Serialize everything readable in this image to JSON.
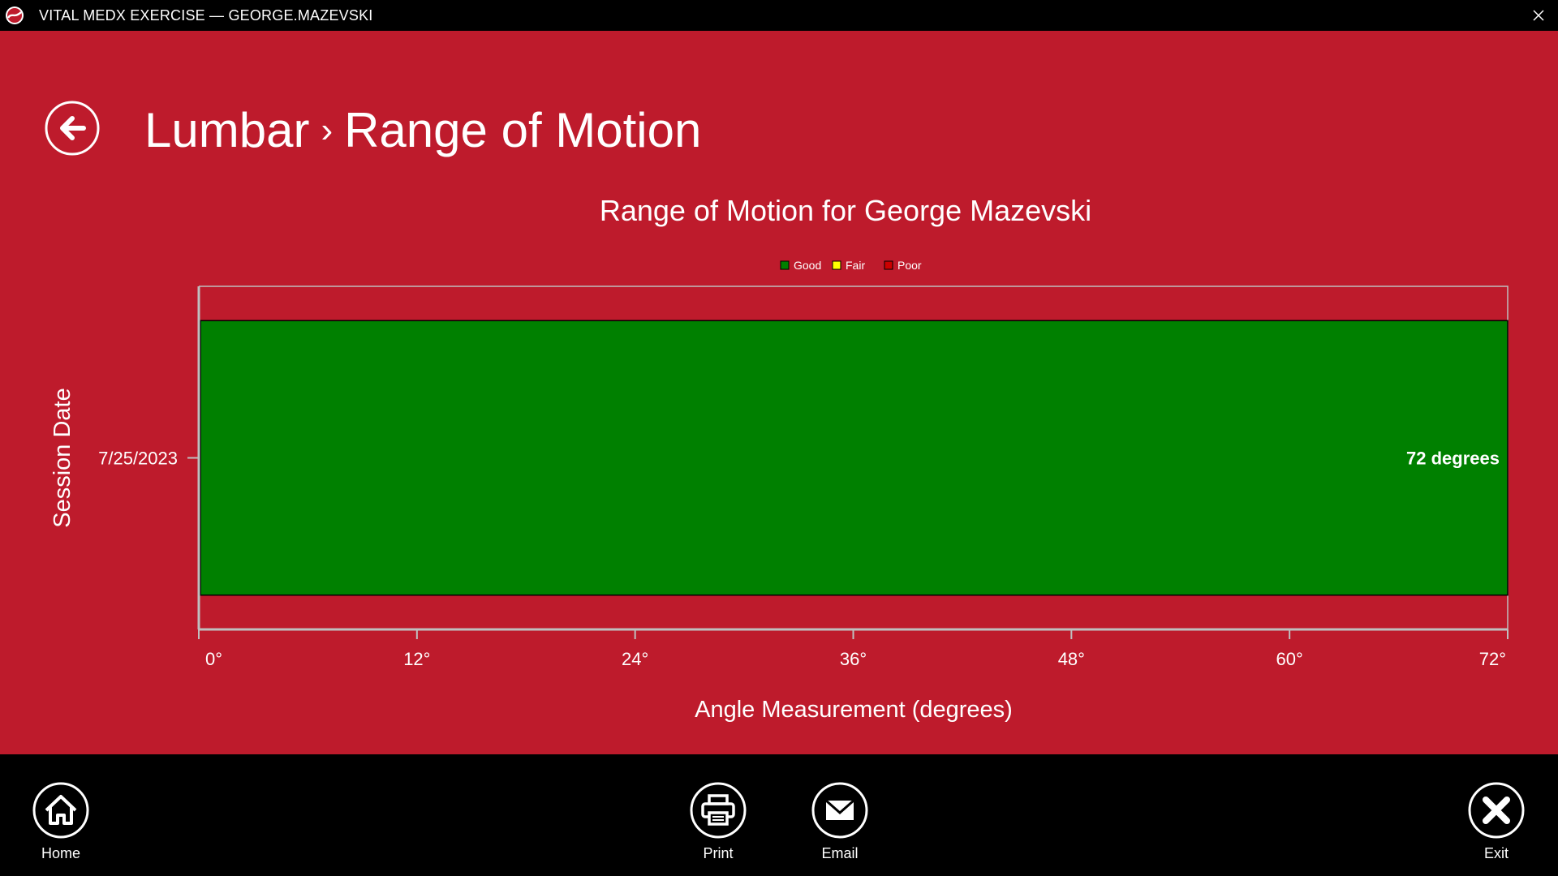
{
  "window": {
    "title": "VITAL MEDX EXERCISE — GEORGE.MAZEVSKI"
  },
  "header": {
    "breadcrumb_parent": "Lumbar",
    "breadcrumb_separator": "›",
    "breadcrumb_current": "Range of Motion"
  },
  "colors": {
    "background": "#BE1B2C",
    "good": "#008000",
    "fair": "#FFFF00",
    "poor": "#CC0000",
    "axis": "#BFBFBF"
  },
  "chart_data": {
    "type": "bar",
    "orientation": "horizontal",
    "title": "Range of Motion for George Mazevski",
    "xlabel": "Angle Measurement (degrees)",
    "ylabel": "Session Date",
    "categories": [
      "7/25/2023"
    ],
    "values": [
      72
    ],
    "bar_status": [
      "Good"
    ],
    "data_labels": [
      "72 degrees"
    ],
    "xlim": [
      0,
      72
    ],
    "x_ticks": [
      0,
      12,
      24,
      36,
      48,
      60,
      72
    ],
    "x_tick_labels": [
      "0°",
      "12°",
      "24°",
      "36°",
      "48°",
      "60°",
      "72°"
    ],
    "legend": {
      "placement": "top-center",
      "entries": [
        {
          "label": "Good",
          "color": "#008000"
        },
        {
          "label": "Fair",
          "color": "#FFFF00"
        },
        {
          "label": "Poor",
          "color": "#CC0000"
        }
      ]
    },
    "grid": false
  },
  "footer": {
    "home_label": "Home",
    "print_label": "Print",
    "email_label": "Email",
    "exit_label": "Exit",
    "icons": {
      "home": "home-icon",
      "print": "printer-icon",
      "email": "envelope-icon",
      "exit": "close-icon"
    }
  }
}
